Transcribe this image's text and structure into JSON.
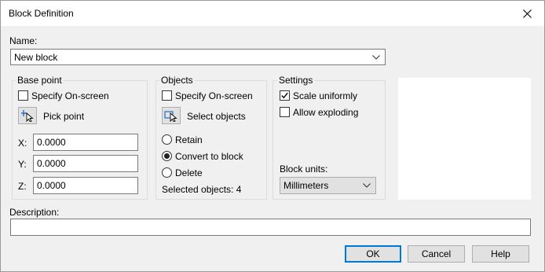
{
  "window": {
    "title": "Block Definition",
    "close_glyph": "close-icon"
  },
  "name": {
    "label": "Name:",
    "value": "New block"
  },
  "base_point": {
    "title": "Base point",
    "specify_label": "Specify On-screen",
    "specify_checked": false,
    "pick_label": "Pick point",
    "x_label": "X:",
    "x_value": "0.0000",
    "y_label": "Y:",
    "y_value": "0.0000",
    "z_label": "Z:",
    "z_value": "0.0000"
  },
  "objects": {
    "title": "Objects",
    "specify_label": "Specify On-screen",
    "specify_checked": false,
    "select_label": "Select objects",
    "retain_label": "Retain",
    "convert_label": "Convert to block",
    "delete_label": "Delete",
    "selected_value": "convert",
    "selected_count_text": "Selected objects: 4"
  },
  "settings": {
    "title": "Settings",
    "scale_label": "Scale uniformly",
    "scale_checked": true,
    "explode_label": "Allow exploding",
    "explode_checked": false,
    "units_label": "Block units:",
    "units_value": "Millimeters"
  },
  "description": {
    "label": "Description:",
    "value": ""
  },
  "buttons": {
    "ok": "OK",
    "cancel": "Cancel",
    "help": "Help"
  },
  "colors": {
    "accent": "#0078d7",
    "group_border": "#dcdcdc"
  }
}
